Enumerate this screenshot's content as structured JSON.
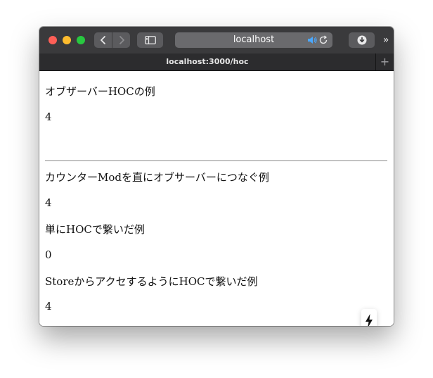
{
  "browser": {
    "address_text": "localhost",
    "tab_title": "localhost:3000/hoc",
    "more_label": "»",
    "new_tab_label": "+"
  },
  "page": {
    "heading1": "オブザーバーHOCの例",
    "value1": "4",
    "heading2": "カウンターModを直にオブサーバーにつなぐ例",
    "value2": "4",
    "heading3": "単にHOCで繋いだ例",
    "value3": "0",
    "heading4": "StoreからアクセするようにHOCで繋いだ例",
    "value4": "4",
    "plus_label": "+",
    "minus_label": "-"
  },
  "colors": {
    "titlebar": "#3a3a3c",
    "tabbar": "#2c2c2e",
    "speaker_accent": "#4aa8ff"
  }
}
